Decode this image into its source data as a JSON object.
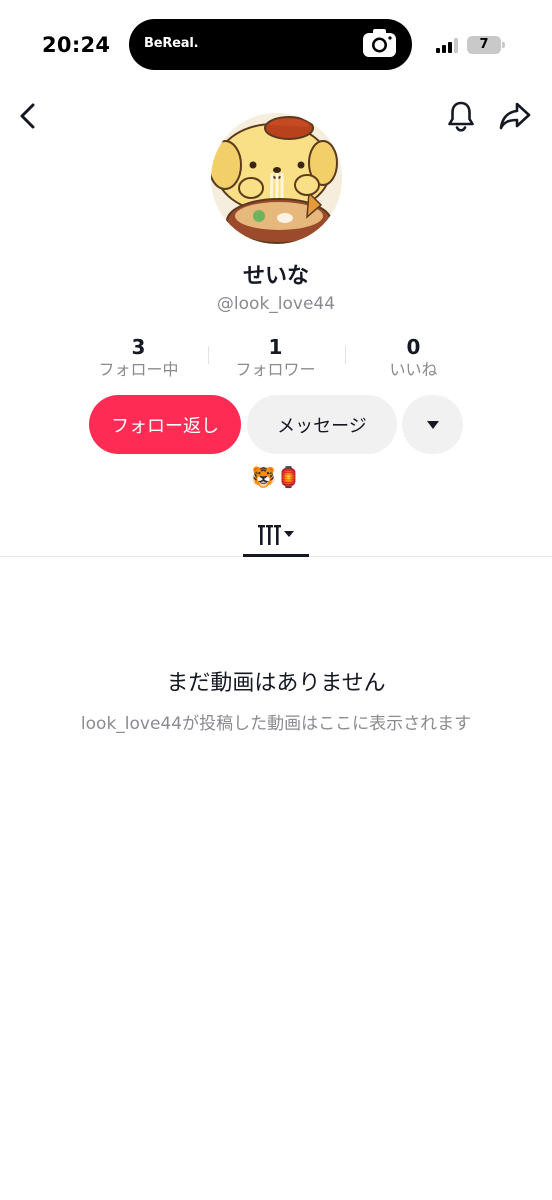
{
  "status_bar": {
    "time": "20:24",
    "island_app": "BeReal.",
    "battery_level": "7"
  },
  "nav": {
    "back_icon": "chevron-left-icon",
    "bell_icon": "bell-icon",
    "share_icon": "share-arrow-icon"
  },
  "profile": {
    "display_name": "せいな",
    "username": "@look_love44",
    "bio": "🐯🏮"
  },
  "stats": [
    {
      "value": "3",
      "label": "フォロー中"
    },
    {
      "value": "1",
      "label": "フォロワー"
    },
    {
      "value": "0",
      "label": "いいね"
    }
  ],
  "actions": {
    "follow_back": "フォロー返し",
    "message": "メッセージ"
  },
  "empty_state": {
    "title": "まだ動画はありません",
    "subtitle": "look_love44が投稿した動画はここに表示されます"
  },
  "colors": {
    "accent": "#fe2c55",
    "secondary_button": "#f1f1f2",
    "muted_text": "#8a8b91"
  }
}
